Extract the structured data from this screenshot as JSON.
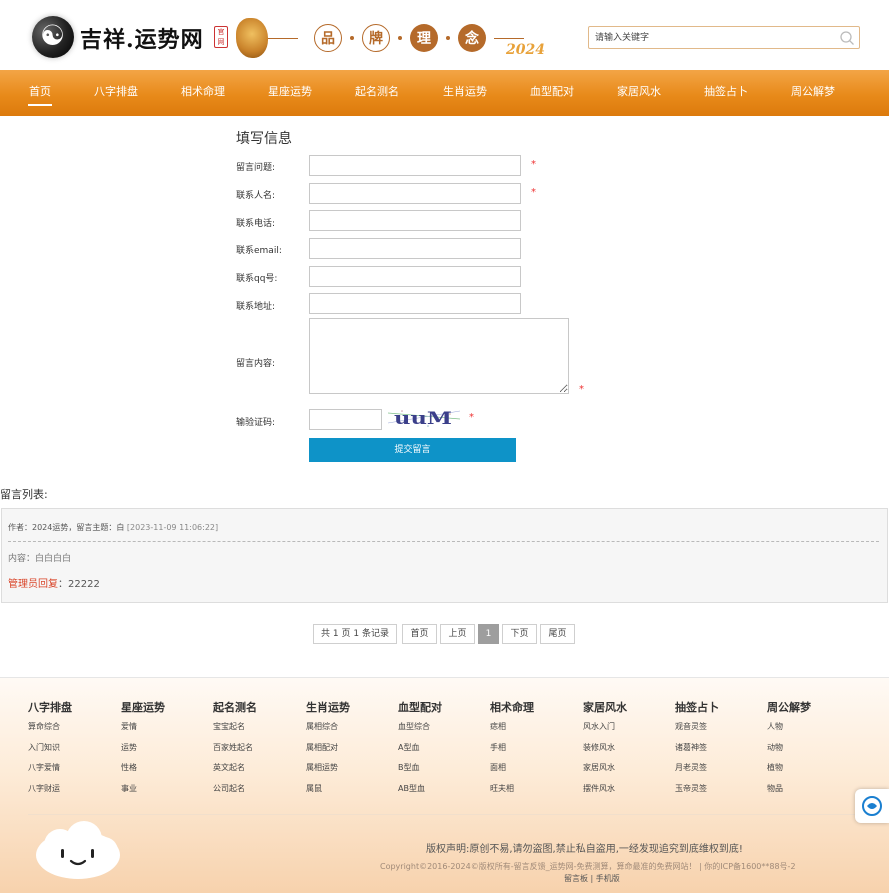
{
  "header": {
    "logo_text": "吉祥.运势网",
    "logo_badge": "官网",
    "motto": [
      "品",
      "牌",
      "理",
      "念"
    ],
    "year": "2024",
    "search_placeholder": "请输入关键字"
  },
  "nav": {
    "items": [
      "首页",
      "八字排盘",
      "相术命理",
      "星座运势",
      "起名测名",
      "生肖运势",
      "血型配对",
      "家居风水",
      "抽签占卜",
      "周公解梦"
    ],
    "active_index": 0
  },
  "form": {
    "title": "填写信息",
    "labels": {
      "subject": "留言问题:",
      "name": "联系人名:",
      "phone": "联系电话:",
      "email": "联系email:",
      "qq": "联系qq号:",
      "address": "联系地址:",
      "content": "留言内容:",
      "captcha": "输验证码:"
    },
    "required_mark": "*",
    "captcha_text": "uuM",
    "submit_label": "提交留言"
  },
  "comments": {
    "title": "留言列表:",
    "items": [
      {
        "meta": "作者：2024运势，留言主题：白",
        "date": "[2023-11-09 11:06:22]",
        "content": "内容：白白白白",
        "reply_label": "管理员回复",
        "reply_text": "：22222"
      }
    ]
  },
  "pagination": {
    "summary": "共 1 页 1 条记录",
    "first": "首页",
    "prev": "上页",
    "current": "1",
    "next": "下页",
    "last": "尾页"
  },
  "footer": {
    "columns": [
      {
        "title": "八字排盘",
        "links": [
          "算命综合",
          "入门知识",
          "八字爱情",
          "八字财运"
        ]
      },
      {
        "title": "星座运势",
        "links": [
          "爱情",
          "运势",
          "性格",
          "事业"
        ]
      },
      {
        "title": "起名测名",
        "links": [
          "宝宝起名",
          "百家姓起名",
          "英文起名",
          "公司起名"
        ]
      },
      {
        "title": "生肖运势",
        "links": [
          "属相综合",
          "属相配对",
          "属相运势",
          "属鼠"
        ]
      },
      {
        "title": "血型配对",
        "links": [
          "血型综合",
          "A型血",
          "B型血",
          "AB型血"
        ]
      },
      {
        "title": "相术命理",
        "links": [
          "痣相",
          "手相",
          "面相",
          "旺夫相"
        ]
      },
      {
        "title": "家居风水",
        "links": [
          "风水入门",
          "装修风水",
          "家居风水",
          "摆件风水"
        ]
      },
      {
        "title": "抽签占卜",
        "links": [
          "观音灵签",
          "诸葛神签",
          "月老灵签",
          "玉帝灵签"
        ]
      },
      {
        "title": "周公解梦",
        "links": [
          "人物",
          "动物",
          "植物",
          "物品"
        ]
      }
    ],
    "statement": "版权声明:原创不易,请勿盗图,禁止私自盗用,一经发现追究到底维权到底!",
    "copyright": "Copyright©2016-2024©版权所有-留言反馈_运势网-免费测算，算命最准的免费网站！ | 你的ICP备1600**88号-2",
    "bottom_links": "留言板 | 手机版"
  },
  "colors": {
    "nav_orange": "#e88a1a",
    "brand_brown": "#b56a2a",
    "submit_blue": "#0e93c8",
    "required_red": "#e33333",
    "admin_red": "#d9452a"
  }
}
